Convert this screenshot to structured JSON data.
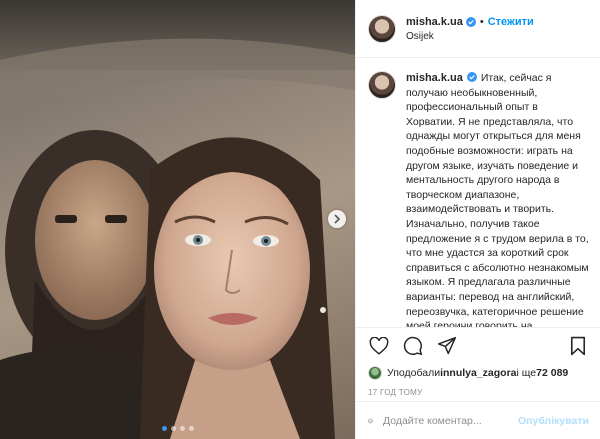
{
  "post": {
    "username": "misha.k.ua",
    "follow_label": "Стежити",
    "separator": "•",
    "location": "Osijek",
    "caption": "Итак, сейчас я получаю необыкновенный, профессиональный опыт в Хорватии. Я не представляла, что однажды могут открыться для меня подобные возможности: играть на другом языке, изучать поведение и ментальность другого народа в творческом диапазоне, взаимодействовать и творить. Изначально, получив такое предложение я с трудом верила в то, что мне удастся за короткий срок справиться с абсолютно незнакомым языком. Я предлагала различные варианты: перевод на английский, переозвучка, категоричное решение моей героини говорить на украинском",
    "likes_prefix": "Уподобали ",
    "likes_user": "innulya_zagora",
    "likes_suffix": " і ще ",
    "likes_count": "72 089",
    "time_ago": "17 ГОД ТОМУ",
    "comment_placeholder": "Додайте коментар...",
    "publish_label": "Опублікувати",
    "carousel": {
      "total": 4,
      "active": 0
    },
    "colors": {
      "accent": "#0095f6",
      "publish_disabled": "#b2dffc",
      "verified": "#3897f0"
    }
  }
}
